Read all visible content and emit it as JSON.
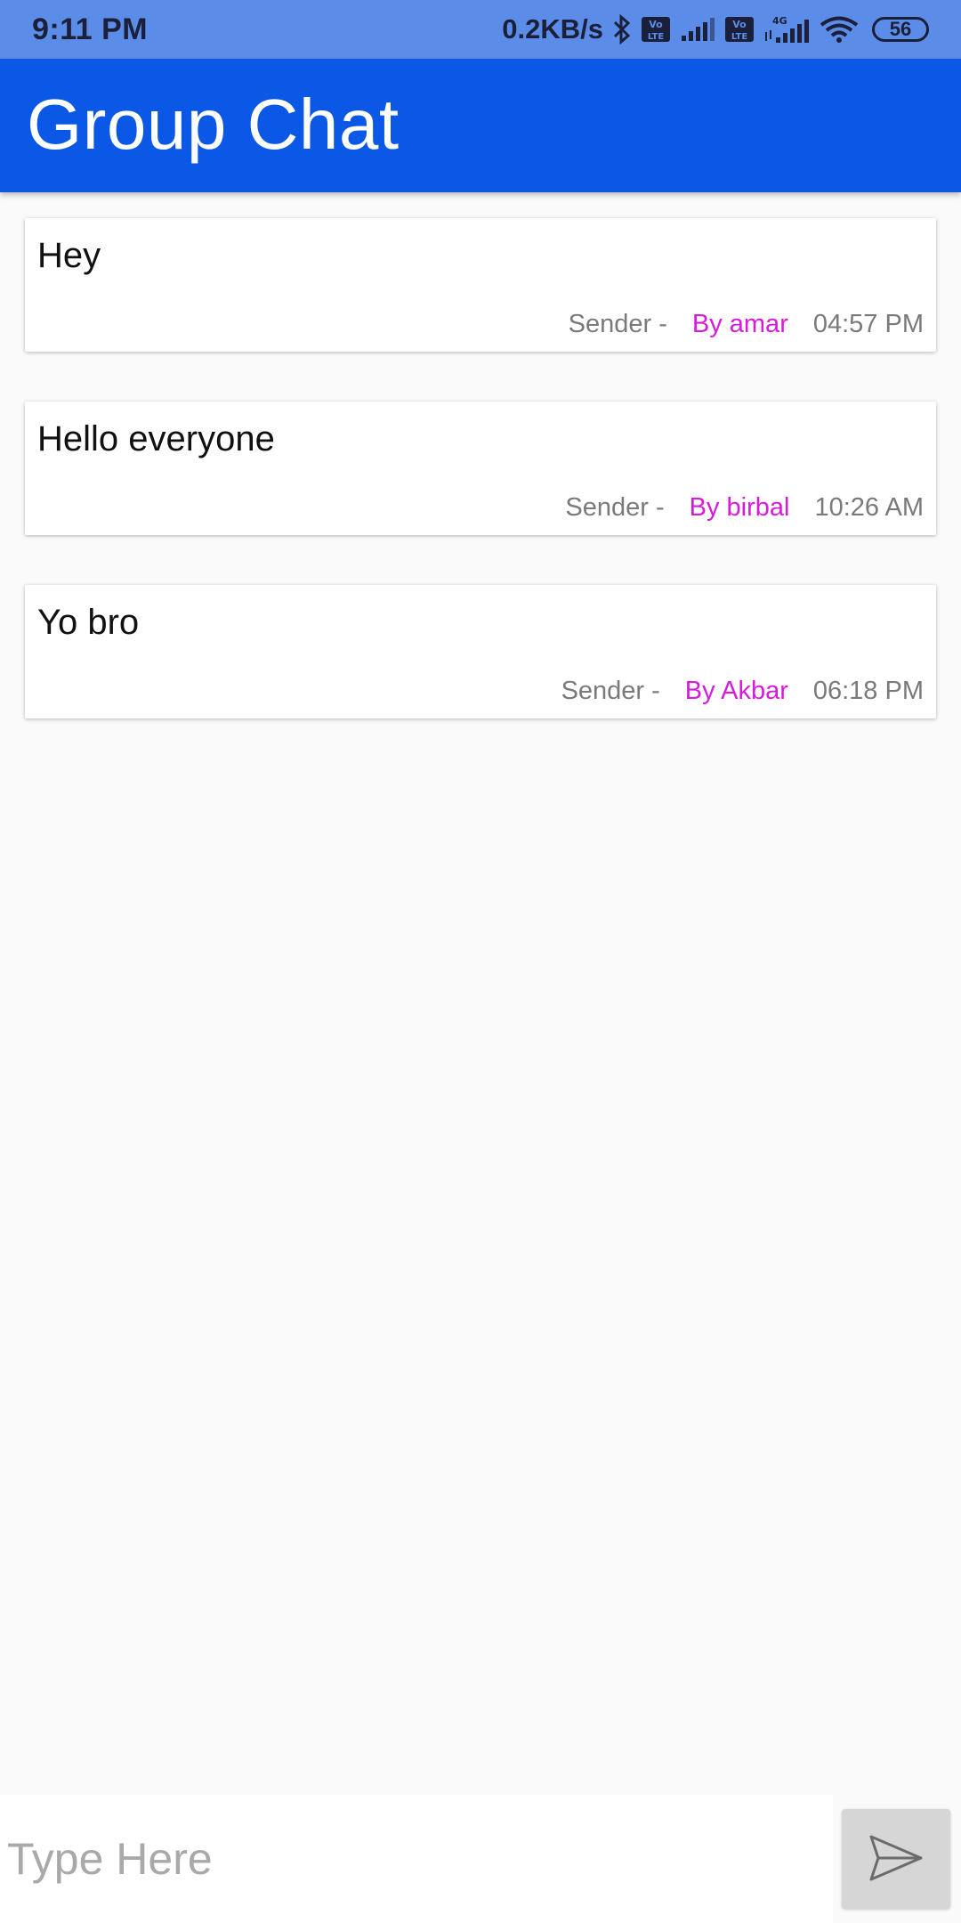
{
  "status_bar": {
    "time": "9:11 PM",
    "net_speed": "0.2KB/s",
    "battery_level": "56",
    "icons": [
      "bluetooth-icon",
      "volte-icon",
      "signal-icon",
      "volte-icon",
      "4g-signal-icon",
      "wifi-icon",
      "battery-icon"
    ]
  },
  "app_bar": {
    "title": "Group Chat",
    "color": "#0b57e6"
  },
  "messages": [
    {
      "text": "Hey",
      "sender_label": "Sender -",
      "sender": "By amar",
      "time": "04:57 PM"
    },
    {
      "text": "Hello everyone",
      "sender_label": "Sender -",
      "sender": "By birbal",
      "time": "10:26 AM"
    },
    {
      "text": "Yo bro",
      "sender_label": "Sender -",
      "sender": "By Akbar",
      "time": "06:18 PM"
    }
  ],
  "composer": {
    "placeholder": "Type Here",
    "value": "",
    "send_icon": "send-icon"
  },
  "colors": {
    "sender": "#d81bdb",
    "status_bar": "#5b8de8",
    "background": "#fafafa"
  }
}
